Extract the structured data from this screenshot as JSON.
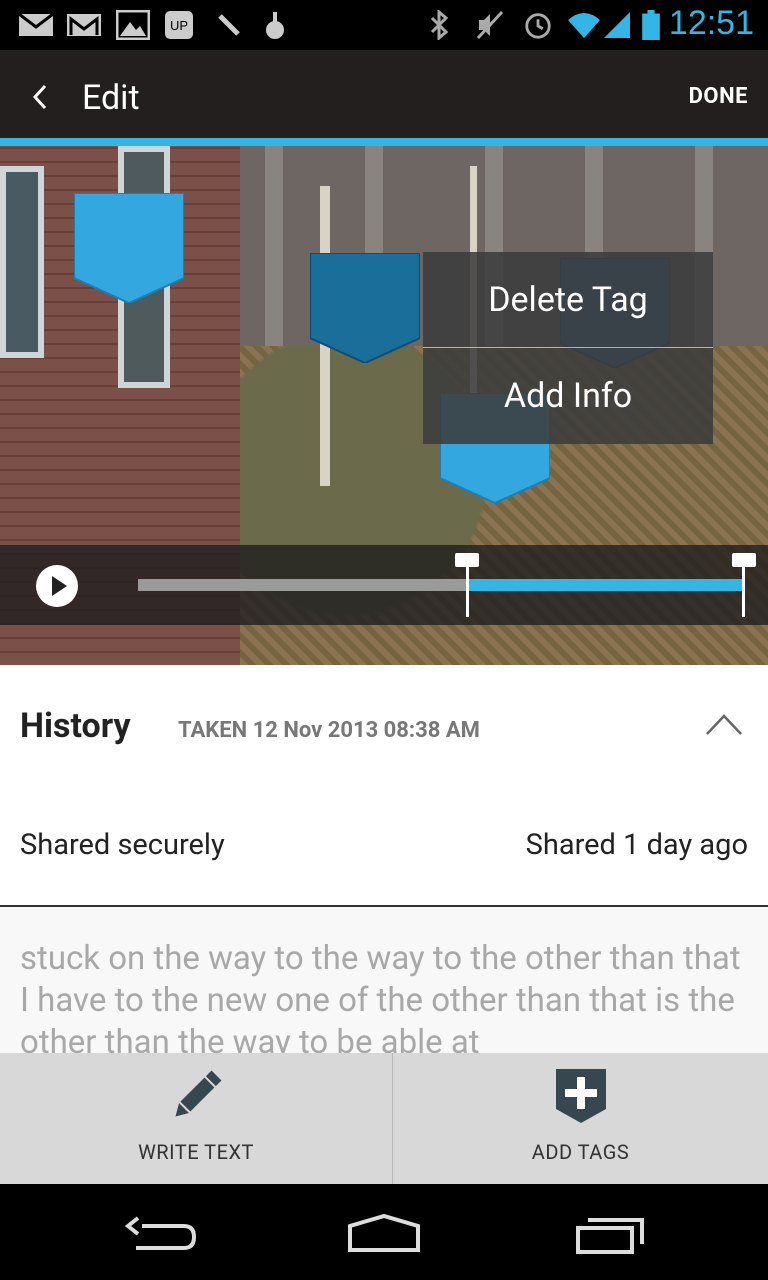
{
  "status_bar": {
    "time": "12:51",
    "icons": [
      "gmail-icon",
      "email-icon",
      "gallery-icon",
      "voicemail-icon",
      "tools-icon",
      "app-icon",
      "bluetooth-icon",
      "mute-icon",
      "alarm-icon",
      "wifi-icon",
      "signal-icon",
      "battery-icon"
    ]
  },
  "action_bar": {
    "title": "Edit",
    "done_label": "DONE"
  },
  "popup_menu": {
    "items": [
      "Delete Tag",
      "Add Info"
    ]
  },
  "player": {
    "trim_start": 0.54,
    "trim_end": 1.0
  },
  "history": {
    "title": "History",
    "taken": "TAKEN 12 Nov 2013 08:38 AM",
    "shared_status": "Shared securely",
    "shared_time": "Shared 1 day ago",
    "notes": "stuck on the way to the way to the other than that I have to the new one of the other than that is the other than the way to be able at"
  },
  "bottom_actions": {
    "write_text_label": "WRITE TEXT",
    "add_tags_label": "ADD TAGS"
  },
  "colors": {
    "accent": "#33b5e5",
    "action_bar": "#231f1f"
  }
}
